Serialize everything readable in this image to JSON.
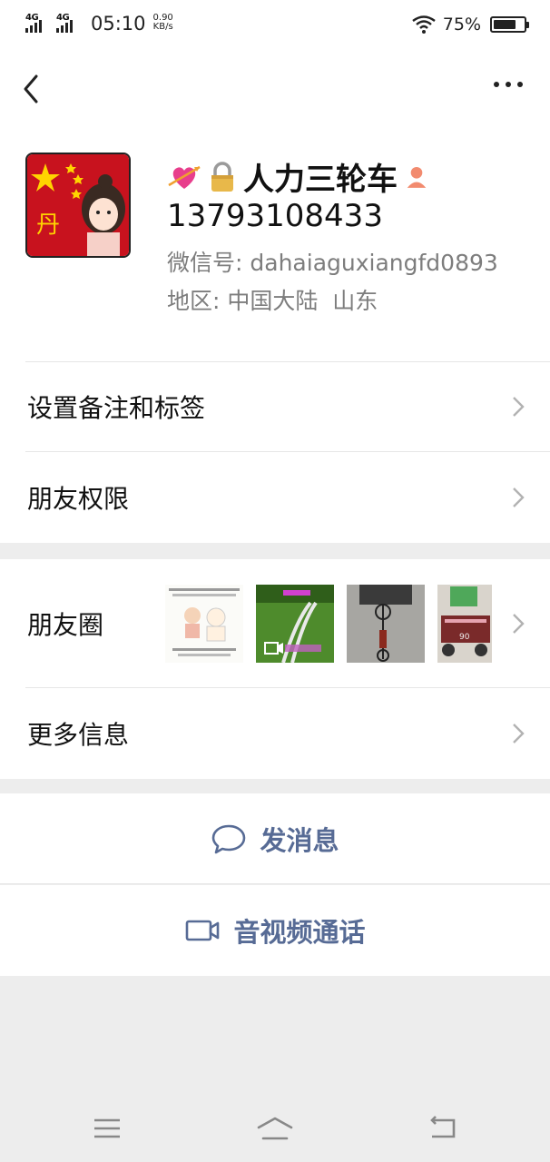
{
  "status_bar": {
    "network_1": "4G",
    "network_2": "4G",
    "time": "05:10",
    "speed_value": "0.90",
    "speed_unit": "KB/s",
    "battery_percent": "75%",
    "battery_level": 0.75
  },
  "nav": {
    "back_icon": "chevron-left-icon",
    "more_icon": "more-dots-icon"
  },
  "profile": {
    "avatar_icon": "avatar-image",
    "name": "人力三轮车",
    "phone": "13793108433",
    "wechat_id_label": "微信号:",
    "wechat_id": "dahaiaguxiangfd0893",
    "region_label": "地区:",
    "region": "中国大陆  山东"
  },
  "menu": {
    "remark_tags": "设置备注和标签",
    "friend_permissions": "朋友权限",
    "moments": "朋友圈",
    "more_info": "更多信息"
  },
  "moments_thumbs": {
    "thumb4_label": "90"
  },
  "actions": {
    "send_message": "发消息",
    "video_call": "音视频通话"
  },
  "colors": {
    "link_blue": "#576b95",
    "background": "#ededed"
  }
}
